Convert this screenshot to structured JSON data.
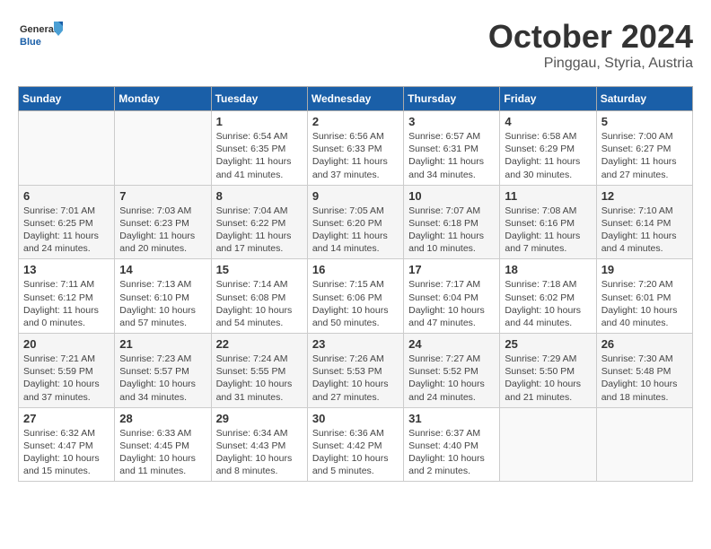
{
  "header": {
    "logo_line1": "General",
    "logo_line2": "Blue",
    "month": "October 2024",
    "location": "Pinggau, Styria, Austria"
  },
  "weekdays": [
    "Sunday",
    "Monday",
    "Tuesday",
    "Wednesday",
    "Thursday",
    "Friday",
    "Saturday"
  ],
  "weeks": [
    [
      {
        "day": "",
        "info": ""
      },
      {
        "day": "",
        "info": ""
      },
      {
        "day": "1",
        "info": "Sunrise: 6:54 AM\nSunset: 6:35 PM\nDaylight: 11 hours and 41 minutes."
      },
      {
        "day": "2",
        "info": "Sunrise: 6:56 AM\nSunset: 6:33 PM\nDaylight: 11 hours and 37 minutes."
      },
      {
        "day": "3",
        "info": "Sunrise: 6:57 AM\nSunset: 6:31 PM\nDaylight: 11 hours and 34 minutes."
      },
      {
        "day": "4",
        "info": "Sunrise: 6:58 AM\nSunset: 6:29 PM\nDaylight: 11 hours and 30 minutes."
      },
      {
        "day": "5",
        "info": "Sunrise: 7:00 AM\nSunset: 6:27 PM\nDaylight: 11 hours and 27 minutes."
      }
    ],
    [
      {
        "day": "6",
        "info": "Sunrise: 7:01 AM\nSunset: 6:25 PM\nDaylight: 11 hours and 24 minutes."
      },
      {
        "day": "7",
        "info": "Sunrise: 7:03 AM\nSunset: 6:23 PM\nDaylight: 11 hours and 20 minutes."
      },
      {
        "day": "8",
        "info": "Sunrise: 7:04 AM\nSunset: 6:22 PM\nDaylight: 11 hours and 17 minutes."
      },
      {
        "day": "9",
        "info": "Sunrise: 7:05 AM\nSunset: 6:20 PM\nDaylight: 11 hours and 14 minutes."
      },
      {
        "day": "10",
        "info": "Sunrise: 7:07 AM\nSunset: 6:18 PM\nDaylight: 11 hours and 10 minutes."
      },
      {
        "day": "11",
        "info": "Sunrise: 7:08 AM\nSunset: 6:16 PM\nDaylight: 11 hours and 7 minutes."
      },
      {
        "day": "12",
        "info": "Sunrise: 7:10 AM\nSunset: 6:14 PM\nDaylight: 11 hours and 4 minutes."
      }
    ],
    [
      {
        "day": "13",
        "info": "Sunrise: 7:11 AM\nSunset: 6:12 PM\nDaylight: 11 hours and 0 minutes."
      },
      {
        "day": "14",
        "info": "Sunrise: 7:13 AM\nSunset: 6:10 PM\nDaylight: 10 hours and 57 minutes."
      },
      {
        "day": "15",
        "info": "Sunrise: 7:14 AM\nSunset: 6:08 PM\nDaylight: 10 hours and 54 minutes."
      },
      {
        "day": "16",
        "info": "Sunrise: 7:15 AM\nSunset: 6:06 PM\nDaylight: 10 hours and 50 minutes."
      },
      {
        "day": "17",
        "info": "Sunrise: 7:17 AM\nSunset: 6:04 PM\nDaylight: 10 hours and 47 minutes."
      },
      {
        "day": "18",
        "info": "Sunrise: 7:18 AM\nSunset: 6:02 PM\nDaylight: 10 hours and 44 minutes."
      },
      {
        "day": "19",
        "info": "Sunrise: 7:20 AM\nSunset: 6:01 PM\nDaylight: 10 hours and 40 minutes."
      }
    ],
    [
      {
        "day": "20",
        "info": "Sunrise: 7:21 AM\nSunset: 5:59 PM\nDaylight: 10 hours and 37 minutes."
      },
      {
        "day": "21",
        "info": "Sunrise: 7:23 AM\nSunset: 5:57 PM\nDaylight: 10 hours and 34 minutes."
      },
      {
        "day": "22",
        "info": "Sunrise: 7:24 AM\nSunset: 5:55 PM\nDaylight: 10 hours and 31 minutes."
      },
      {
        "day": "23",
        "info": "Sunrise: 7:26 AM\nSunset: 5:53 PM\nDaylight: 10 hours and 27 minutes."
      },
      {
        "day": "24",
        "info": "Sunrise: 7:27 AM\nSunset: 5:52 PM\nDaylight: 10 hours and 24 minutes."
      },
      {
        "day": "25",
        "info": "Sunrise: 7:29 AM\nSunset: 5:50 PM\nDaylight: 10 hours and 21 minutes."
      },
      {
        "day": "26",
        "info": "Sunrise: 7:30 AM\nSunset: 5:48 PM\nDaylight: 10 hours and 18 minutes."
      }
    ],
    [
      {
        "day": "27",
        "info": "Sunrise: 6:32 AM\nSunset: 4:47 PM\nDaylight: 10 hours and 15 minutes."
      },
      {
        "day": "28",
        "info": "Sunrise: 6:33 AM\nSunset: 4:45 PM\nDaylight: 10 hours and 11 minutes."
      },
      {
        "day": "29",
        "info": "Sunrise: 6:34 AM\nSunset: 4:43 PM\nDaylight: 10 hours and 8 minutes."
      },
      {
        "day": "30",
        "info": "Sunrise: 6:36 AM\nSunset: 4:42 PM\nDaylight: 10 hours and 5 minutes."
      },
      {
        "day": "31",
        "info": "Sunrise: 6:37 AM\nSunset: 4:40 PM\nDaylight: 10 hours and 2 minutes."
      },
      {
        "day": "",
        "info": ""
      },
      {
        "day": "",
        "info": ""
      }
    ]
  ]
}
